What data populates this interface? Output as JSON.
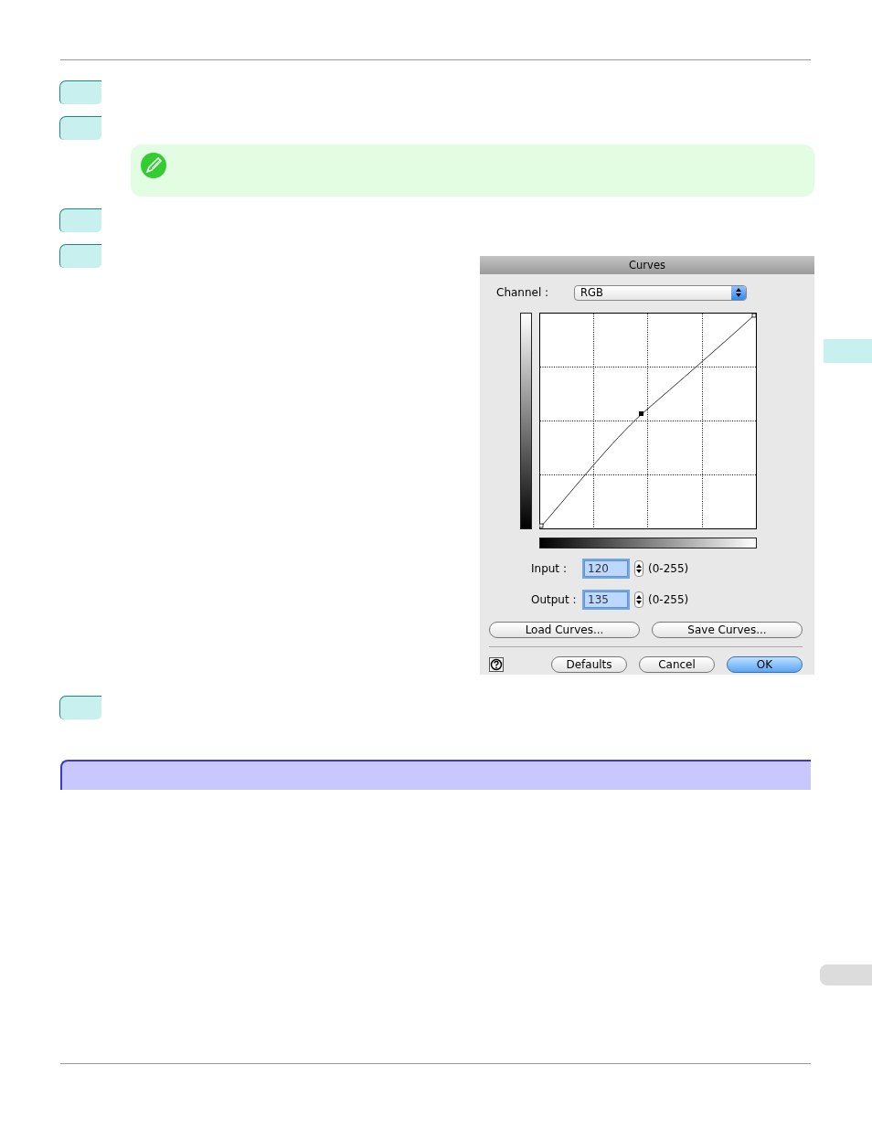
{
  "steps_top": [
    {
      "kind": "marker"
    },
    {
      "kind": "marker"
    }
  ],
  "note": {
    "kind": "pencil"
  },
  "steps_mid": [
    {
      "kind": "marker"
    },
    {
      "kind": "marker"
    }
  ],
  "dialog": {
    "title": "Curves",
    "channel": {
      "label": "Channel :",
      "value": "RGB"
    },
    "fields": [
      {
        "label": "Input :",
        "value": "120",
        "range": "(0-255)",
        "focused": true
      },
      {
        "label": "Output :",
        "value": "135",
        "range": "(0-255)",
        "focused": true
      }
    ],
    "file_buttons": [
      "Load Curves...",
      "Save Curves..."
    ],
    "buttons": [
      {
        "label": "Defaults",
        "default": false
      },
      {
        "label": "Cancel",
        "default": false
      },
      {
        "label": "OK",
        "default": true
      }
    ]
  },
  "steps_bottom": [
    {
      "kind": "marker"
    }
  ],
  "side_tabs": [
    {
      "color": "#c8f0ee"
    },
    {
      "color": "#dcdcdc"
    }
  ]
}
